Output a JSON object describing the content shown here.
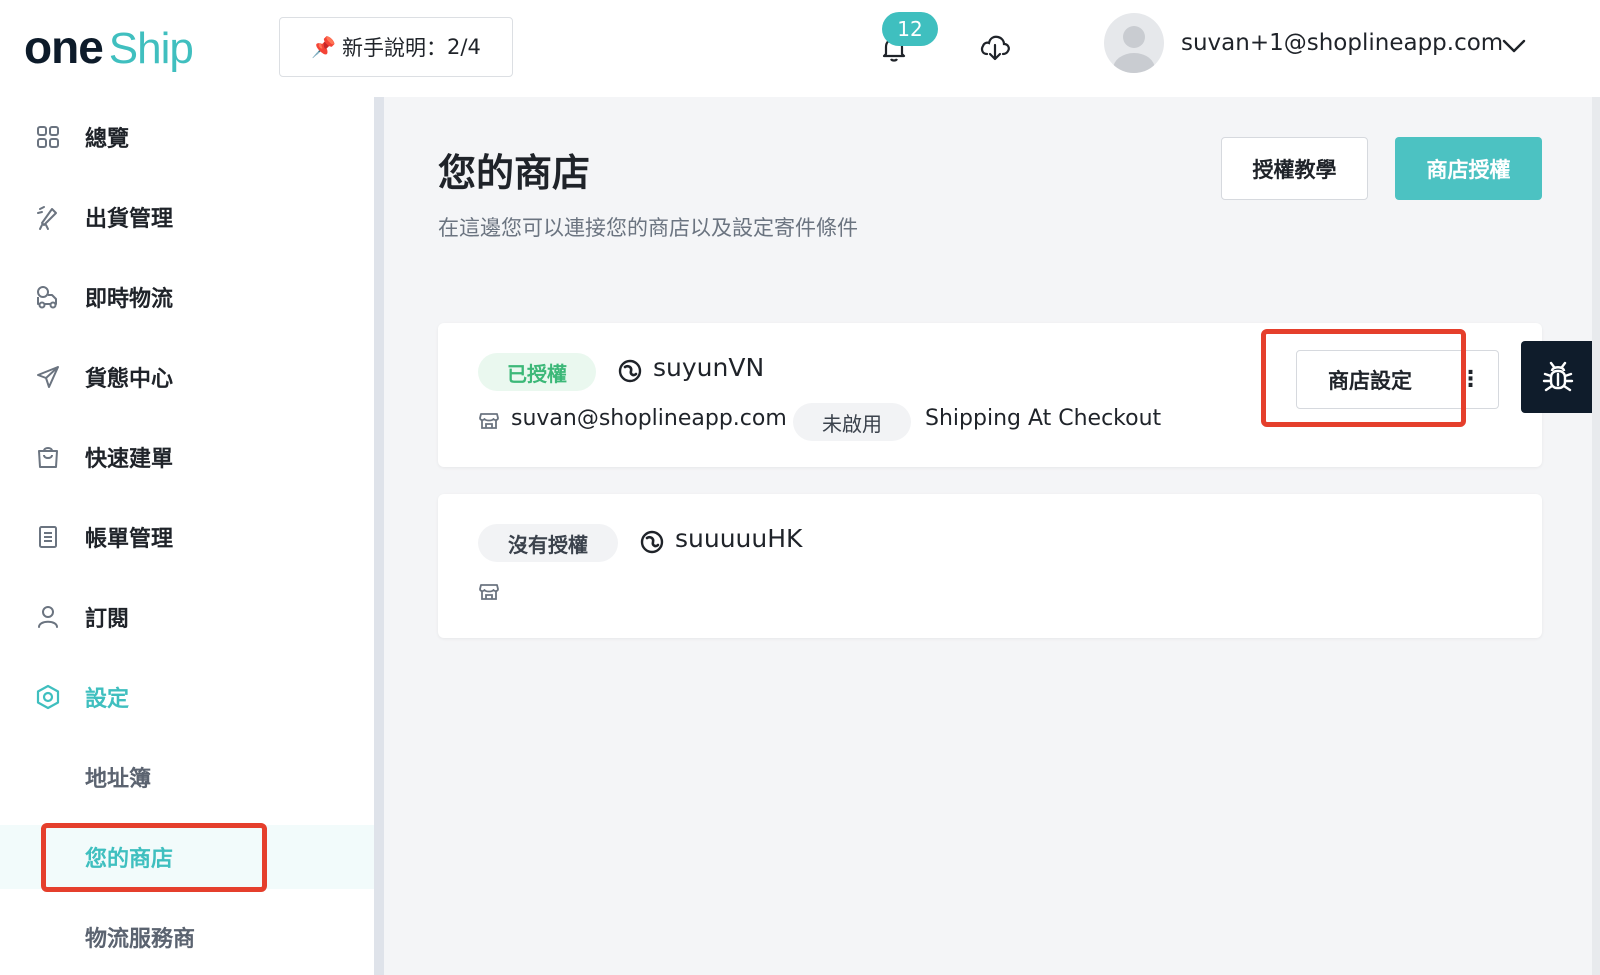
{
  "header": {
    "logo_one": "one",
    "logo_ship": "Ship",
    "guide_label": "新手說明：",
    "guide_progress": "2/4",
    "notification_count": "12",
    "user_email": "suvan+1@shoplineapp.com"
  },
  "sidebar": {
    "items": [
      {
        "label": "總覽",
        "icon": "grid-icon"
      },
      {
        "label": "出貨管理",
        "icon": "rocket-icon"
      },
      {
        "label": "即時物流",
        "icon": "delivery-truck-icon"
      },
      {
        "label": "貨態中心",
        "icon": "send-icon"
      },
      {
        "label": "快速建單",
        "icon": "shopping-bag-icon"
      },
      {
        "label": "帳單管理",
        "icon": "document-icon"
      },
      {
        "label": "訂閱",
        "icon": "user-icon"
      },
      {
        "label": "設定",
        "icon": "settings-hexagon-icon"
      }
    ],
    "sub_items": [
      {
        "label": "地址簿"
      },
      {
        "label": "您的商店"
      },
      {
        "label": "物流服務商"
      }
    ]
  },
  "main": {
    "title": "您的商店",
    "subtitle": "在這邊您可以連接您的商店以及設定寄件條件",
    "tutorial_button": "授權教學",
    "authorize_button": "商店授權",
    "stores": [
      {
        "status": "已授權",
        "name": "suyunVN",
        "email": "suvan@shoplineapp.com",
        "feature_status": "未啟用",
        "feature": "Shipping At Checkout",
        "settings_button": "商店設定",
        "more_button": "⋮"
      },
      {
        "status": "沒有授權",
        "name": "suuuuuHK"
      }
    ]
  },
  "colors": {
    "accent": "#3fbfbf",
    "highlight": "#e53f2c",
    "authorized": "#3cb878",
    "debug_bg": "#0f1c2b"
  }
}
